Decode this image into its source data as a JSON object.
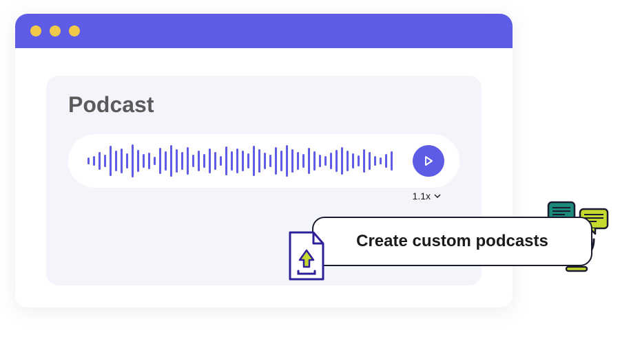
{
  "panel": {
    "title": "Podcast"
  },
  "player": {
    "speed_label": "1.1x",
    "waveform_heights": [
      10,
      14,
      26,
      18,
      44,
      30,
      36,
      22,
      48,
      32,
      20,
      24,
      12,
      38,
      28,
      46,
      34,
      26,
      40,
      18,
      30,
      20,
      36,
      26,
      14,
      42,
      28,
      36,
      30,
      22,
      44,
      34,
      24,
      18,
      40,
      30,
      46,
      34,
      26,
      20,
      38,
      28,
      18,
      14,
      24,
      32,
      40,
      30,
      22,
      16,
      34,
      26,
      14,
      10,
      20,
      28
    ]
  },
  "callout": {
    "label": "Create custom podcasts"
  }
}
